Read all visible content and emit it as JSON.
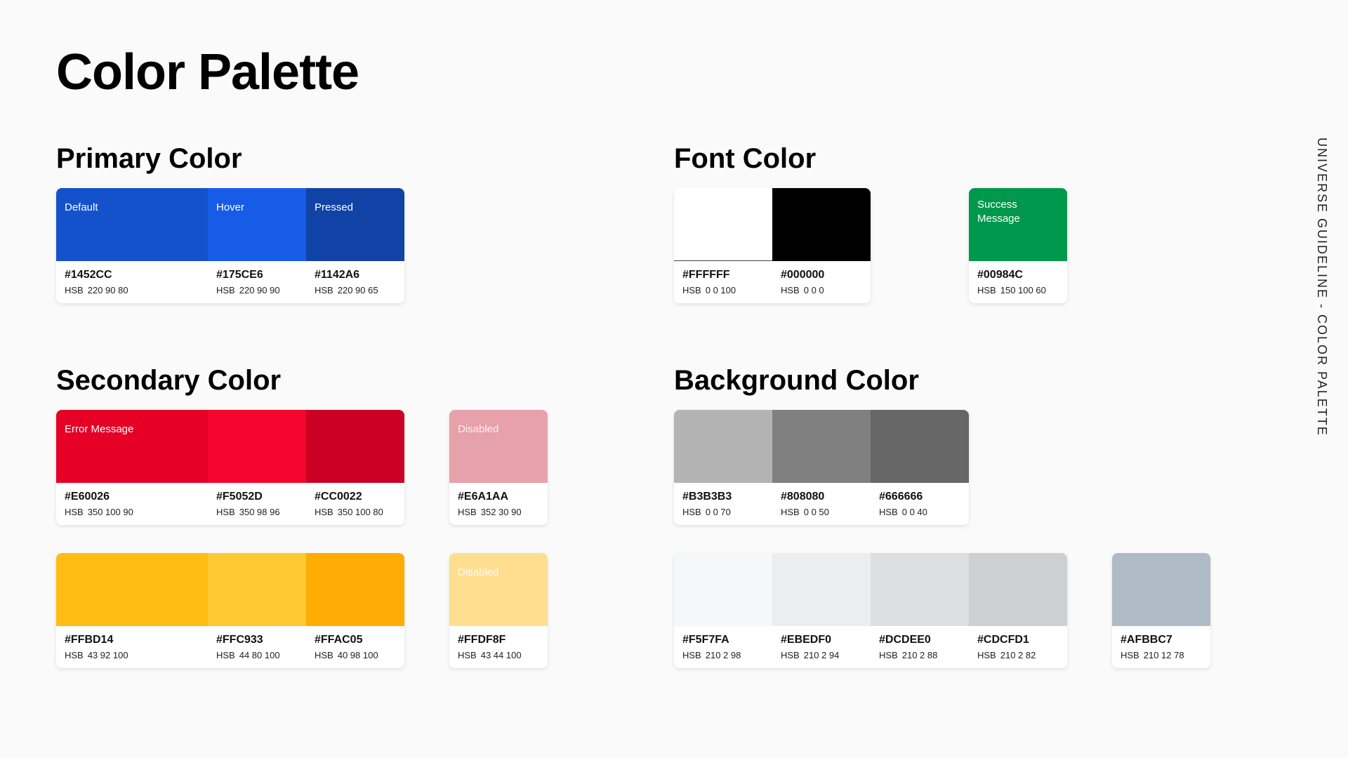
{
  "page": {
    "title": "Color Palette",
    "side_label": "UNIVERSE GUIDELINE - COLOR PALETTE"
  },
  "primary": {
    "title": "Primary Color",
    "swatches": [
      {
        "label": "Default",
        "color": "#1452CC",
        "hex": "#1452CC",
        "hsb": "220 90 80"
      },
      {
        "label": "Hover",
        "color": "#175CE6",
        "hex": "#175CE6",
        "hsb": "220 90 90"
      },
      {
        "label": "Pressed",
        "color": "#1142A6",
        "hex": "#1142A6",
        "hsb": "220 90 65"
      }
    ]
  },
  "secondary": {
    "title": "Secondary Color",
    "red": [
      {
        "label": "Error Message",
        "color": "#E60026",
        "hex": "#E60026",
        "hsb": "350 100 90"
      },
      {
        "label": "",
        "color": "#F5052D",
        "hex": "#F5052D",
        "hsb": "350 98 96"
      },
      {
        "label": "",
        "color": "#CC0022",
        "hex": "#CC0022",
        "hsb": "350 100 80"
      }
    ],
    "red_disabled": {
      "label": "Disabled",
      "color": "#E6A1AA",
      "hex": "#E6A1AA",
      "hsb": "352 30 90"
    },
    "yellow": [
      {
        "label": "",
        "color": "#FFBD14",
        "hex": "#FFBD14",
        "hsb": "43 92 100"
      },
      {
        "label": "",
        "color": "#FFC933",
        "hex": "#FFC933",
        "hsb": "44 80 100"
      },
      {
        "label": "",
        "color": "#FFAC05",
        "hex": "#FFAC05",
        "hsb": "40 98 100"
      }
    ],
    "yellow_disabled": {
      "label": "Disabled",
      "color": "#FFDF8F",
      "hex": "#FFDF8F",
      "hsb": "43 44 100"
    }
  },
  "font": {
    "title": "Font Color",
    "swatches": [
      {
        "label": "",
        "color": "#FFFFFF",
        "hex": "#FFFFFF",
        "hsb": "0 0 100"
      },
      {
        "label": "",
        "color": "#000000",
        "hex": "#000000",
        "hsb": "0 0 0"
      }
    ],
    "success": {
      "label_line1": "Success",
      "label_line2": "Message",
      "color": "#00984C",
      "hex": "#00984C",
      "hsb": "150 100 60"
    }
  },
  "background": {
    "title": "Background Color",
    "grays": [
      {
        "label": "",
        "color": "#B3B3B3",
        "hex": "#B3B3B3",
        "hsb": "0 0 70"
      },
      {
        "label": "",
        "color": "#808080",
        "hex": "#808080",
        "hsb": "0 0 50"
      },
      {
        "label": "",
        "color": "#666666",
        "hex": "#666666",
        "hsb": "0 0 40"
      }
    ],
    "lights": [
      {
        "label": "",
        "color": "#F5F7FA",
        "hex": "#F5F7FA",
        "hsb": "210 2 98"
      },
      {
        "label": "",
        "color": "#EBEDF0",
        "hex": "#EBEDF0",
        "hsb": "210 2 94"
      },
      {
        "label": "",
        "color": "#DCDEE0",
        "hex": "#DCDEE0",
        "hsb": "210 2 88"
      },
      {
        "label": "",
        "color": "#CDCFD1",
        "hex": "#CDCFD1",
        "hsb": "210 2 82"
      }
    ],
    "steel": {
      "label": "",
      "color": "#AFBBC7",
      "hex": "#AFBBC7",
      "hsb": "210 12 78"
    }
  },
  "hsb_prefix": "HSB"
}
